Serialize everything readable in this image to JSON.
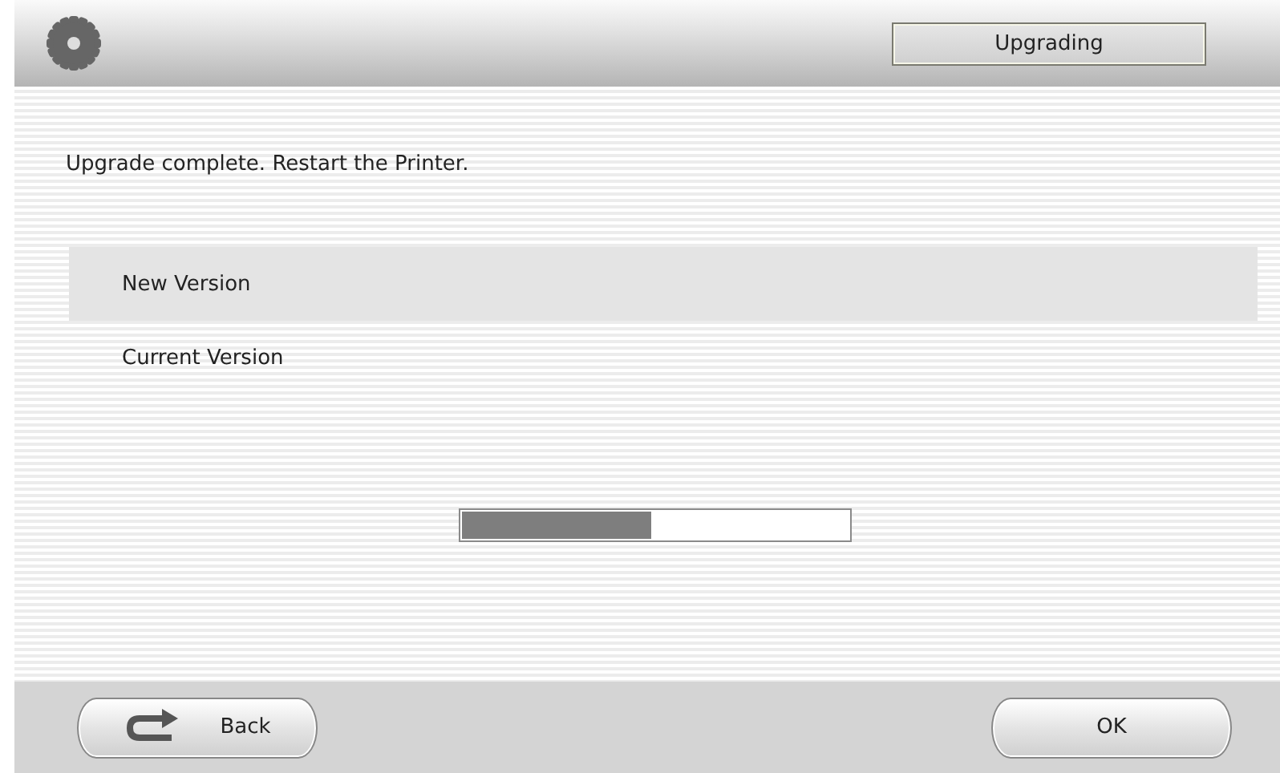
{
  "header": {
    "status": "Upgrading"
  },
  "message": "Upgrade complete. Restart the Printer.",
  "versions": [
    {
      "label": "New Version",
      "selected": true
    },
    {
      "label": "Current Version",
      "selected": false
    }
  ],
  "progress": {
    "level": 0.49
  },
  "footer": {
    "back": "Back",
    "ok": "OK"
  }
}
